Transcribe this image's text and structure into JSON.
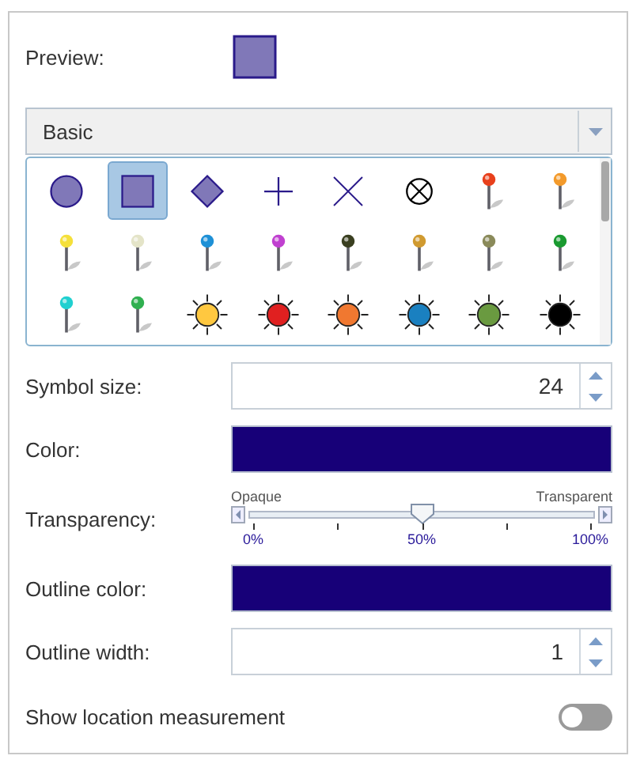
{
  "preview": {
    "label": "Preview:",
    "kind": "square"
  },
  "category": {
    "value": "Basic"
  },
  "symbols": [
    {
      "kind": "circle",
      "selected": false
    },
    {
      "kind": "square",
      "selected": true
    },
    {
      "kind": "diamond",
      "selected": false
    },
    {
      "kind": "cross",
      "selected": false
    },
    {
      "kind": "x",
      "selected": false
    },
    {
      "kind": "circle-x",
      "selected": false
    },
    {
      "kind": "pin",
      "color": "#e8401c",
      "selected": false
    },
    {
      "kind": "pin",
      "color": "#f39a2b",
      "selected": false
    },
    {
      "kind": "pin",
      "color": "#f5e03a",
      "selected": false
    },
    {
      "kind": "pin",
      "color": "#e4e4c8",
      "selected": false
    },
    {
      "kind": "pin",
      "color": "#1e90d6",
      "selected": false
    },
    {
      "kind": "pin",
      "color": "#c040d0",
      "selected": false
    },
    {
      "kind": "pin",
      "color": "#3a3f20",
      "selected": false
    },
    {
      "kind": "pin",
      "color": "#d09a30",
      "selected": false
    },
    {
      "kind": "pin",
      "color": "#8a8a5a",
      "selected": false
    },
    {
      "kind": "pin",
      "color": "#1a9a30",
      "selected": false
    },
    {
      "kind": "pin",
      "color": "#20d0d0",
      "selected": false
    },
    {
      "kind": "pin",
      "color": "#30b050",
      "selected": false
    },
    {
      "kind": "sun",
      "color": "#ffc840",
      "selected": false
    },
    {
      "kind": "sun",
      "color": "#e02020",
      "selected": false
    },
    {
      "kind": "sun",
      "color": "#f07830",
      "selected": false
    },
    {
      "kind": "sun",
      "color": "#1a80c0",
      "selected": false
    },
    {
      "kind": "sun",
      "color": "#6a9a40",
      "selected": false
    },
    {
      "kind": "sun",
      "color": "#000000",
      "selected": false
    }
  ],
  "symbol_size": {
    "label": "Symbol size:",
    "value": "24"
  },
  "color": {
    "label": "Color:",
    "color": "#170078"
  },
  "transparency": {
    "label": "Transparency:",
    "min_label": "Opaque",
    "max_label": "Transparent",
    "level": 0.5,
    "ticks": [
      "0%",
      "50%",
      "100%"
    ]
  },
  "outline_color": {
    "label": "Outline color:",
    "color": "#170078"
  },
  "outline_width": {
    "label": "Outline width:",
    "value": "1"
  },
  "show_location_measurement": {
    "label": "Show location measurement",
    "on": false
  }
}
